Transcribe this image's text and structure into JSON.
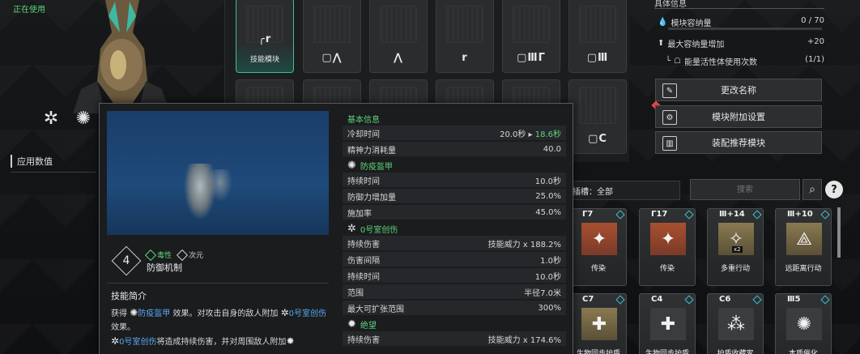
{
  "status": {
    "in_use": "正在使用"
  },
  "left": {
    "applied_values": "应用数值"
  },
  "module_grid": {
    "active_slot_label": "技能模块",
    "slot_marks": [
      "╭r",
      "▢⋀",
      "⋀",
      "r",
      "▢ⅢΓ",
      "▢Ⅲ",
      "▢C"
    ]
  },
  "info": {
    "title": "具体信息",
    "capacity_label": "模块容纳量",
    "capacity_value": "0 / 70",
    "max_increase_label": "最大容纳量增加",
    "max_increase_value": "+20",
    "energy_label": "能量活性体使用次数",
    "energy_value": "(1/1)"
  },
  "buttons": {
    "rename": "更改名称",
    "addon": "模块附加设置",
    "recommend": "装配推荐模块"
  },
  "filter": {
    "label": "插槽：全部"
  },
  "search": {
    "placeholder": "搜索"
  },
  "cards": [
    {
      "cost": "Γ7",
      "name": "传染",
      "style": "red",
      "glyph": "✦"
    },
    {
      "cost": "Γ17",
      "name": "传染",
      "style": "red",
      "glyph": "✦"
    },
    {
      "cost": "Ⅲ+14",
      "name": "多重行动",
      "style": "gold",
      "glyph": "✧",
      "badge": "x2"
    },
    {
      "cost": "Ⅲ+10",
      "name": "远距离行动",
      "style": "gold",
      "glyph": "⟁"
    },
    {
      "cost": "C7",
      "name": "生物同步护盾",
      "style": "gold",
      "glyph": "✚"
    },
    {
      "cost": "C4",
      "name": "生物同步护盾",
      "style": "plain",
      "glyph": "✚"
    },
    {
      "cost": "C6",
      "name": "护盾收藏家",
      "style": "plain",
      "glyph": "⁂"
    },
    {
      "cost": "Ⅲ5",
      "name": "本质催化",
      "style": "plain",
      "glyph": "✺"
    }
  ],
  "tooltip": {
    "rank": "4",
    "tag_toxic": "毒性",
    "tag_dim": "次元",
    "module_name": "防御机制",
    "desc_title": "技能简介",
    "desc_1a": "获得 ",
    "desc_1b": "防疫盔甲",
    "desc_1c": " 效果。对攻击自身的敌人附加 ",
    "desc_1d": "0号室创伤",
    "desc_1e": " 效果。",
    "desc_2a": "0号室创伤",
    "desc_2b": "将造成持续伤害，并对周围敌人附加",
    "sections": [
      {
        "title": "基本信息",
        "rows": [
          {
            "k": "冷却时间",
            "v": "20.0秒 ▸ ",
            "v2": "18.6秒"
          },
          {
            "k": "精神力消耗量",
            "v": "40.0"
          }
        ]
      },
      {
        "title": "防疫盔甲",
        "rows": [
          {
            "k": "持续时间",
            "v": "10.0秒"
          },
          {
            "k": "防御力增加量",
            "v": "25.0%"
          },
          {
            "k": "施加率",
            "v": "45.0%"
          }
        ]
      },
      {
        "title": "0号室创伤",
        "rows": [
          {
            "k": "持续伤害",
            "v": "技能威力 x 188.2%"
          },
          {
            "k": "伤害间隔",
            "v": "1.0秒"
          },
          {
            "k": "持续时间",
            "v": "10.0秒"
          },
          {
            "k": "范围",
            "v": "半径7.0米"
          },
          {
            "k": "最大可扩张范围",
            "v": "300%"
          }
        ]
      },
      {
        "title": "绝望",
        "rows": [
          {
            "k": "持续伤害",
            "v": "技能威力 x 174.6%"
          }
        ]
      }
    ]
  }
}
